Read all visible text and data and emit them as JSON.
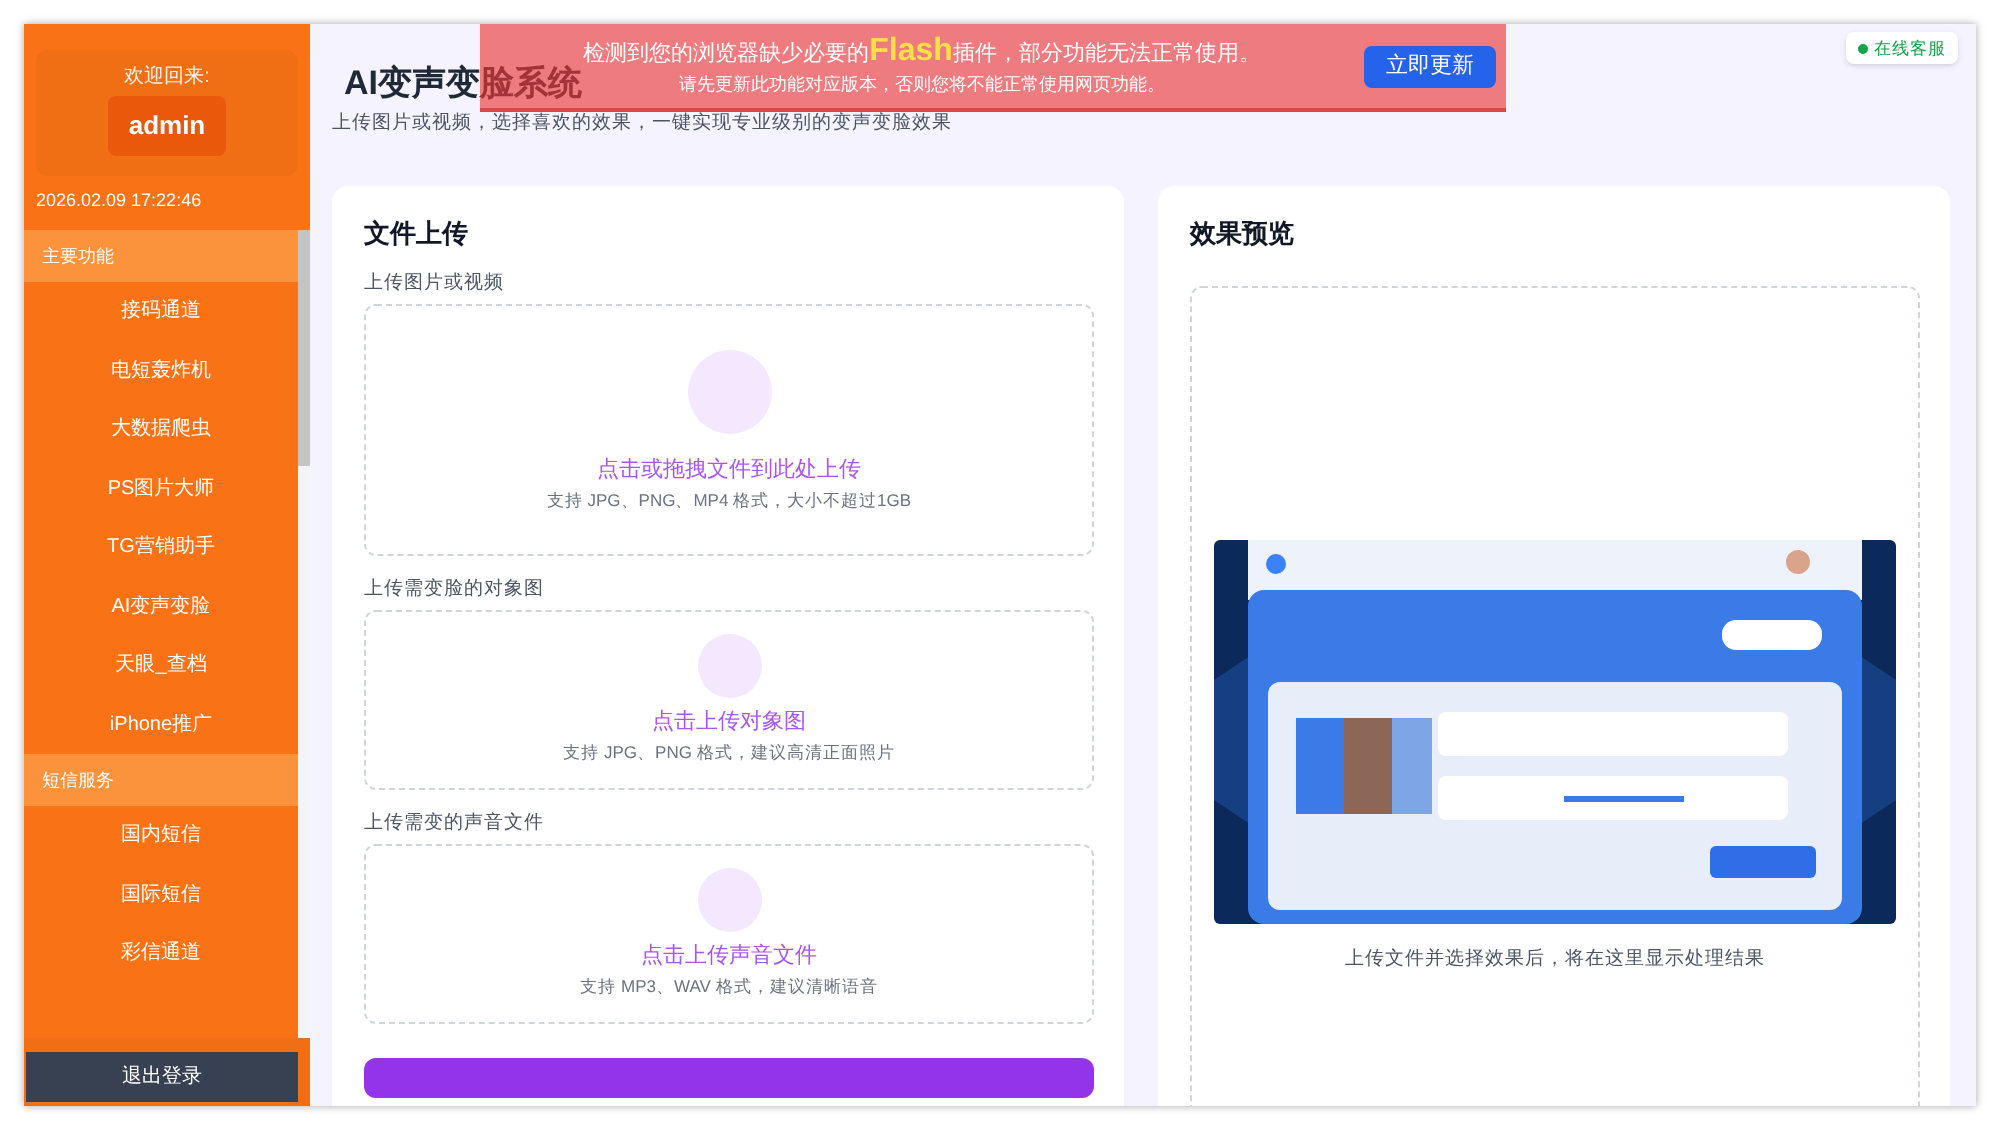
{
  "sidebar": {
    "welcome": "欢迎回来:",
    "username": "admin",
    "datetime": "2026.02.09 17:22:46",
    "sections": [
      {
        "title": "主要功能",
        "items": [
          "接码通道",
          "电短轰炸机",
          "大数据爬虫",
          "PS图片大师",
          "TG营销助手",
          "AI变声变脸",
          "天眼_查档",
          "iPhone推广"
        ]
      },
      {
        "title": "短信服务",
        "items": [
          "国内短信",
          "国际短信",
          "彩信通道"
        ]
      }
    ],
    "logout": "退出登录"
  },
  "banner": {
    "text_before": "检测到您的浏览器缺少必要的",
    "highlight": "Flash",
    "text_after": "插件，部分功能无法正常使用。",
    "line2": "请先更新此功能对应版本，否则您将不能正常使用网页功能。",
    "button": "立即更新"
  },
  "header": {
    "title": "AI变声变脸系统",
    "subtitle": "上传图片或视频，选择喜欢的效果，一键实现专业级别的变声变脸效果"
  },
  "support_badge": {
    "label": "在线客服"
  },
  "upload_card": {
    "title": "文件上传",
    "fields": [
      {
        "kind": "large",
        "label": "上传图片或视频",
        "prompt": "点击或拖拽文件到此处上传",
        "hint": "支持 JPG、PNG、MP4 格式，大小不超过1GB"
      },
      {
        "kind": "small",
        "label": "上传需变脸的对象图",
        "prompt": "点击上传对象图",
        "hint": "支持 JPG、PNG 格式，建议高清正面照片"
      },
      {
        "kind": "small",
        "label": "上传需变的声音文件",
        "prompt": "点击上传声音文件",
        "hint": "支持 MP3、WAV 格式，建议清晰语音"
      }
    ]
  },
  "preview_card": {
    "title": "效果预览",
    "caption": "上传文件并选择效果后，将在这里显示处理结果"
  }
}
